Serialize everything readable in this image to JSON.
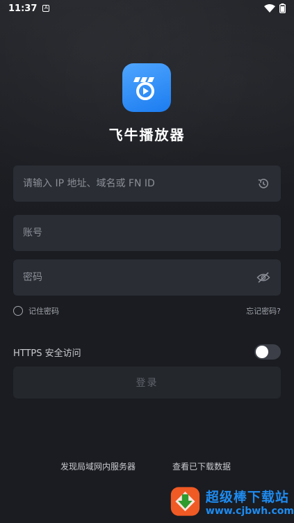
{
  "status_bar": {
    "time": "11:37",
    "icons": [
      "notification-icon",
      "wifi-icon",
      "battery-icon"
    ]
  },
  "app": {
    "name": "飞牛播放器",
    "logo_icon": "fnos-logo-icon",
    "brand_color": "#2486f5"
  },
  "form": {
    "server_placeholder": "请输入 IP 地址、域名或 FN ID",
    "server_value": "",
    "account_placeholder": "账号",
    "account_value": "",
    "password_placeholder": "密码",
    "password_value": "",
    "remember_label": "记住密码",
    "remember_checked": false,
    "forgot_label": "忘记密码?",
    "https_label": "HTTPS 安全访问",
    "https_enabled": false,
    "login_label": "登录"
  },
  "footer": {
    "discover_label": "发现局域网内服务器",
    "downloads_label": "查看已下载数据"
  },
  "watermark": {
    "title": "超级棒下载站",
    "url": "www.cjbwh.com"
  }
}
